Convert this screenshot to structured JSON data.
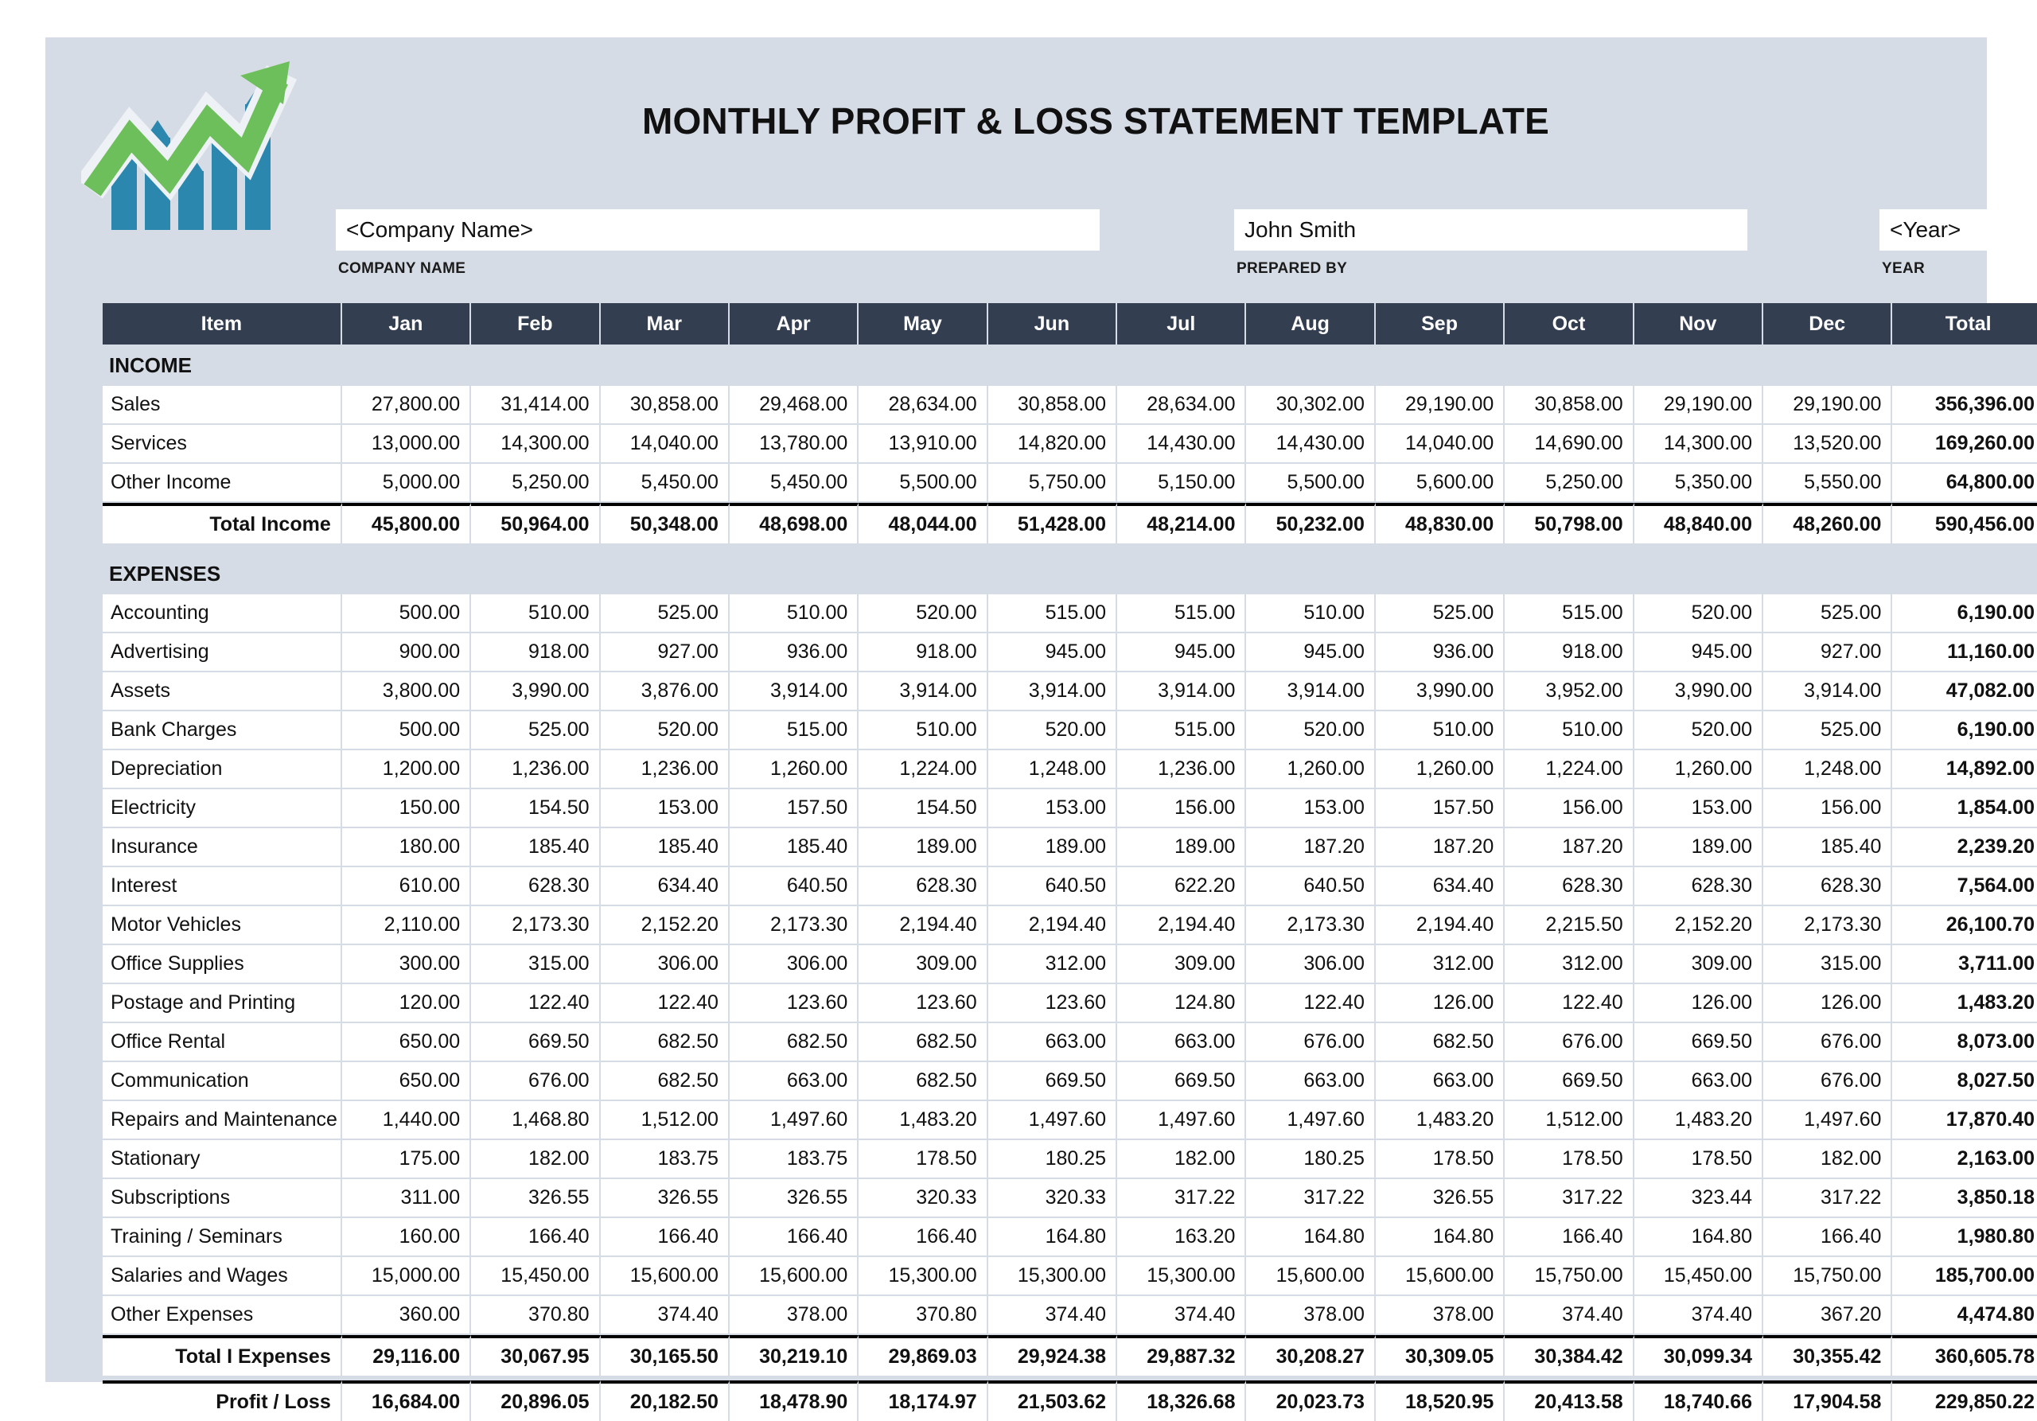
{
  "document": {
    "title": "MONTHLY PROFIT & LOSS STATEMENT TEMPLATE",
    "logo_icon": "growth-arrow-bar-chart-icon"
  },
  "fields": {
    "company_name": {
      "value": "<Company Name>",
      "label": "COMPANY NAME"
    },
    "prepared_by": {
      "value": "John Smith",
      "label": "PREPARED BY"
    },
    "year": {
      "value": "<Year>",
      "label": "YEAR"
    }
  },
  "colors": {
    "sheet_background": "#d6dce5",
    "header_row": "#333f50",
    "header_text": "#ffffff",
    "cell_background": "#ffffff",
    "logo_green": "#6cbf5a",
    "logo_blue": "#2b87ae"
  },
  "table": {
    "columns": [
      "Item",
      "Jan",
      "Feb",
      "Mar",
      "Apr",
      "May",
      "Jun",
      "Jul",
      "Aug",
      "Sep",
      "Oct",
      "Nov",
      "Dec",
      "Total"
    ],
    "sections": [
      {
        "name": "INCOME",
        "rows": [
          {
            "label": "Sales",
            "values": [
              "27,800.00",
              "31,414.00",
              "30,858.00",
              "29,468.00",
              "28,634.00",
              "30,858.00",
              "28,634.00",
              "30,302.00",
              "29,190.00",
              "30,858.00",
              "29,190.00",
              "29,190.00"
            ],
            "total": "356,396.00"
          },
          {
            "label": "Services",
            "values": [
              "13,000.00",
              "14,300.00",
              "14,040.00",
              "13,780.00",
              "13,910.00",
              "14,820.00",
              "14,430.00",
              "14,430.00",
              "14,040.00",
              "14,690.00",
              "14,300.00",
              "13,520.00"
            ],
            "total": "169,260.00"
          },
          {
            "label": "Other Income",
            "values": [
              "5,000.00",
              "5,250.00",
              "5,450.00",
              "5,450.00",
              "5,500.00",
              "5,750.00",
              "5,150.00",
              "5,500.00",
              "5,600.00",
              "5,250.00",
              "5,350.00",
              "5,550.00"
            ],
            "total": "64,800.00"
          }
        ],
        "total_row": {
          "label": "Total Income",
          "values": [
            "45,800.00",
            "50,964.00",
            "50,348.00",
            "48,698.00",
            "48,044.00",
            "51,428.00",
            "48,214.00",
            "50,232.00",
            "48,830.00",
            "50,798.00",
            "48,840.00",
            "48,260.00"
          ],
          "total": "590,456.00"
        }
      },
      {
        "name": "EXPENSES",
        "rows": [
          {
            "label": "Accounting",
            "values": [
              "500.00",
              "510.00",
              "525.00",
              "510.00",
              "520.00",
              "515.00",
              "515.00",
              "510.00",
              "525.00",
              "515.00",
              "520.00",
              "525.00"
            ],
            "total": "6,190.00"
          },
          {
            "label": "Advertising",
            "values": [
              "900.00",
              "918.00",
              "927.00",
              "936.00",
              "918.00",
              "945.00",
              "945.00",
              "945.00",
              "936.00",
              "918.00",
              "945.00",
              "927.00"
            ],
            "total": "11,160.00"
          },
          {
            "label": "Assets",
            "values": [
              "3,800.00",
              "3,990.00",
              "3,876.00",
              "3,914.00",
              "3,914.00",
              "3,914.00",
              "3,914.00",
              "3,914.00",
              "3,990.00",
              "3,952.00",
              "3,990.00",
              "3,914.00"
            ],
            "total": "47,082.00"
          },
          {
            "label": "Bank Charges",
            "values": [
              "500.00",
              "525.00",
              "520.00",
              "515.00",
              "510.00",
              "520.00",
              "515.00",
              "520.00",
              "510.00",
              "510.00",
              "520.00",
              "525.00"
            ],
            "total": "6,190.00"
          },
          {
            "label": "Depreciation",
            "values": [
              "1,200.00",
              "1,236.00",
              "1,236.00",
              "1,260.00",
              "1,224.00",
              "1,248.00",
              "1,236.00",
              "1,260.00",
              "1,260.00",
              "1,224.00",
              "1,260.00",
              "1,248.00"
            ],
            "total": "14,892.00"
          },
          {
            "label": "Electricity",
            "values": [
              "150.00",
              "154.50",
              "153.00",
              "157.50",
              "154.50",
              "153.00",
              "156.00",
              "153.00",
              "157.50",
              "156.00",
              "153.00",
              "156.00"
            ],
            "total": "1,854.00"
          },
          {
            "label": "Insurance",
            "values": [
              "180.00",
              "185.40",
              "185.40",
              "185.40",
              "189.00",
              "189.00",
              "189.00",
              "187.20",
              "187.20",
              "187.20",
              "189.00",
              "185.40"
            ],
            "total": "2,239.20"
          },
          {
            "label": "Interest",
            "values": [
              "610.00",
              "628.30",
              "634.40",
              "640.50",
              "628.30",
              "640.50",
              "622.20",
              "640.50",
              "634.40",
              "628.30",
              "628.30",
              "628.30"
            ],
            "total": "7,564.00"
          },
          {
            "label": "Motor Vehicles",
            "values": [
              "2,110.00",
              "2,173.30",
              "2,152.20",
              "2,173.30",
              "2,194.40",
              "2,194.40",
              "2,194.40",
              "2,173.30",
              "2,194.40",
              "2,215.50",
              "2,152.20",
              "2,173.30"
            ],
            "total": "26,100.70"
          },
          {
            "label": "Office Supplies",
            "values": [
              "300.00",
              "315.00",
              "306.00",
              "306.00",
              "309.00",
              "312.00",
              "309.00",
              "306.00",
              "312.00",
              "312.00",
              "309.00",
              "315.00"
            ],
            "total": "3,711.00"
          },
          {
            "label": "Postage and Printing",
            "values": [
              "120.00",
              "122.40",
              "122.40",
              "123.60",
              "123.60",
              "123.60",
              "124.80",
              "122.40",
              "126.00",
              "122.40",
              "126.00",
              "126.00"
            ],
            "total": "1,483.20"
          },
          {
            "label": "Office Rental",
            "values": [
              "650.00",
              "669.50",
              "682.50",
              "682.50",
              "682.50",
              "663.00",
              "663.00",
              "676.00",
              "682.50",
              "676.00",
              "669.50",
              "676.00"
            ],
            "total": "8,073.00"
          },
          {
            "label": "Communication",
            "values": [
              "650.00",
              "676.00",
              "682.50",
              "663.00",
              "682.50",
              "669.50",
              "669.50",
              "663.00",
              "663.00",
              "669.50",
              "663.00",
              "676.00"
            ],
            "total": "8,027.50"
          },
          {
            "label": "Repairs and Maintenance",
            "values": [
              "1,440.00",
              "1,468.80",
              "1,512.00",
              "1,497.60",
              "1,483.20",
              "1,497.60",
              "1,497.60",
              "1,497.60",
              "1,483.20",
              "1,512.00",
              "1,483.20",
              "1,497.60"
            ],
            "total": "17,870.40"
          },
          {
            "label": "Stationary",
            "values": [
              "175.00",
              "182.00",
              "183.75",
              "183.75",
              "178.50",
              "180.25",
              "182.00",
              "180.25",
              "178.50",
              "178.50",
              "178.50",
              "182.00"
            ],
            "total": "2,163.00"
          },
          {
            "label": "Subscriptions",
            "values": [
              "311.00",
              "326.55",
              "326.55",
              "326.55",
              "320.33",
              "320.33",
              "317.22",
              "317.22",
              "326.55",
              "317.22",
              "323.44",
              "317.22"
            ],
            "total": "3,850.18"
          },
          {
            "label": "Training / Seminars",
            "values": [
              "160.00",
              "166.40",
              "166.40",
              "166.40",
              "166.40",
              "164.80",
              "163.20",
              "164.80",
              "164.80",
              "166.40",
              "164.80",
              "166.40"
            ],
            "total": "1,980.80"
          },
          {
            "label": "Salaries and Wages",
            "values": [
              "15,000.00",
              "15,450.00",
              "15,600.00",
              "15,600.00",
              "15,300.00",
              "15,300.00",
              "15,300.00",
              "15,600.00",
              "15,600.00",
              "15,750.00",
              "15,450.00",
              "15,750.00"
            ],
            "total": "185,700.00"
          },
          {
            "label": "Other Expenses",
            "values": [
              "360.00",
              "370.80",
              "374.40",
              "378.00",
              "370.80",
              "374.40",
              "374.40",
              "378.00",
              "378.00",
              "374.40",
              "374.40",
              "367.20"
            ],
            "total": "4,474.80"
          }
        ],
        "total_row": {
          "label": "Total I Expenses",
          "values": [
            "29,116.00",
            "30,067.95",
            "30,165.50",
            "30,219.10",
            "29,869.03",
            "29,924.38",
            "29,887.32",
            "30,208.27",
            "30,309.05",
            "30,384.42",
            "30,099.34",
            "30,355.42"
          ],
          "total": "360,605.78"
        }
      }
    ],
    "profit_loss_row": {
      "label": "Profit / Loss",
      "values": [
        "16,684.00",
        "20,896.05",
        "20,182.50",
        "18,478.90",
        "18,174.97",
        "21,503.62",
        "18,326.68",
        "20,023.73",
        "18,520.95",
        "20,413.58",
        "18,740.66",
        "17,904.58"
      ],
      "total": "229,850.22"
    }
  }
}
